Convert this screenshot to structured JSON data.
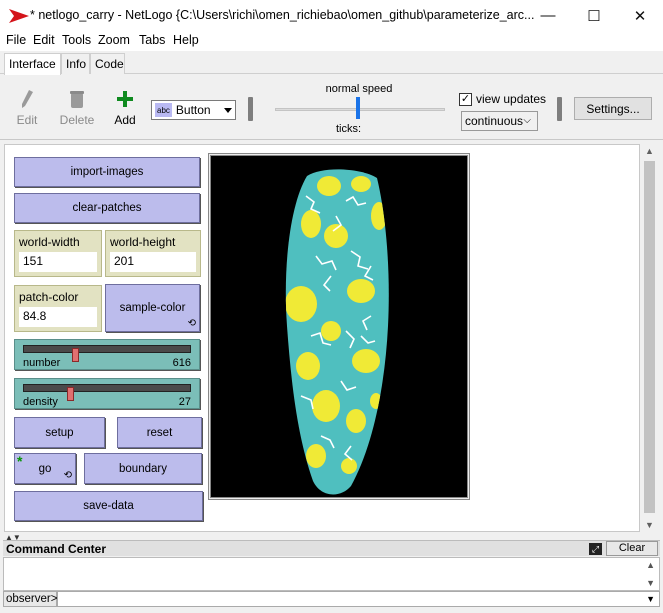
{
  "window": {
    "title": "* netlogo_carry - NetLogo {C:\\Users\\richi\\omen_richiebao\\omen_github\\parameterize_arc...",
    "controls": {
      "minimize": "—",
      "maximize": "☐",
      "close": "✕"
    }
  },
  "menu": [
    "File",
    "Edit",
    "Tools",
    "Zoom",
    "Tabs",
    "Help"
  ],
  "tabs": [
    {
      "label": "Interface",
      "active": true
    },
    {
      "label": "Info",
      "active": false
    },
    {
      "label": "Code",
      "active": false
    }
  ],
  "toolbar": {
    "edit": "Edit",
    "delete": "Delete",
    "add": "Add",
    "widget_type": "Button",
    "widget_tag": "abc",
    "speed_label": "normal speed",
    "ticks_label": "ticks:",
    "view_updates_label": "view updates",
    "view_updates_checked": true,
    "update_mode": "continuous",
    "settings": "Settings...",
    "speed_level": 0.5
  },
  "widgets": {
    "import_images": "import-images",
    "clear_patches": "clear-patches",
    "world_width": {
      "label": "world-width",
      "value": "151"
    },
    "world_height": {
      "label": "world-height",
      "value": "201"
    },
    "patch_color": {
      "label": "patch-color",
      "value": "84.8"
    },
    "sample_color": "sample-color",
    "number_slider": {
      "label": "number",
      "value": "616",
      "fraction": 0.3
    },
    "density_slider": {
      "label": "density",
      "value": "27",
      "fraction": 0.27
    },
    "setup": "setup",
    "reset": "reset",
    "go": "go",
    "boundary": "boundary",
    "save_data": "save-data"
  },
  "colors": {
    "button": "#bcbcec",
    "slider": "#7bbeb8",
    "input": "#e2e2c2",
    "world_bg": "#000000",
    "patch_cyan": "#4fbfbf",
    "patch_yellow": "#f0ea36",
    "patch_white": "#ffffff"
  },
  "command_center": {
    "title": "Command Center",
    "clear": "Clear",
    "observer": "observer>"
  }
}
